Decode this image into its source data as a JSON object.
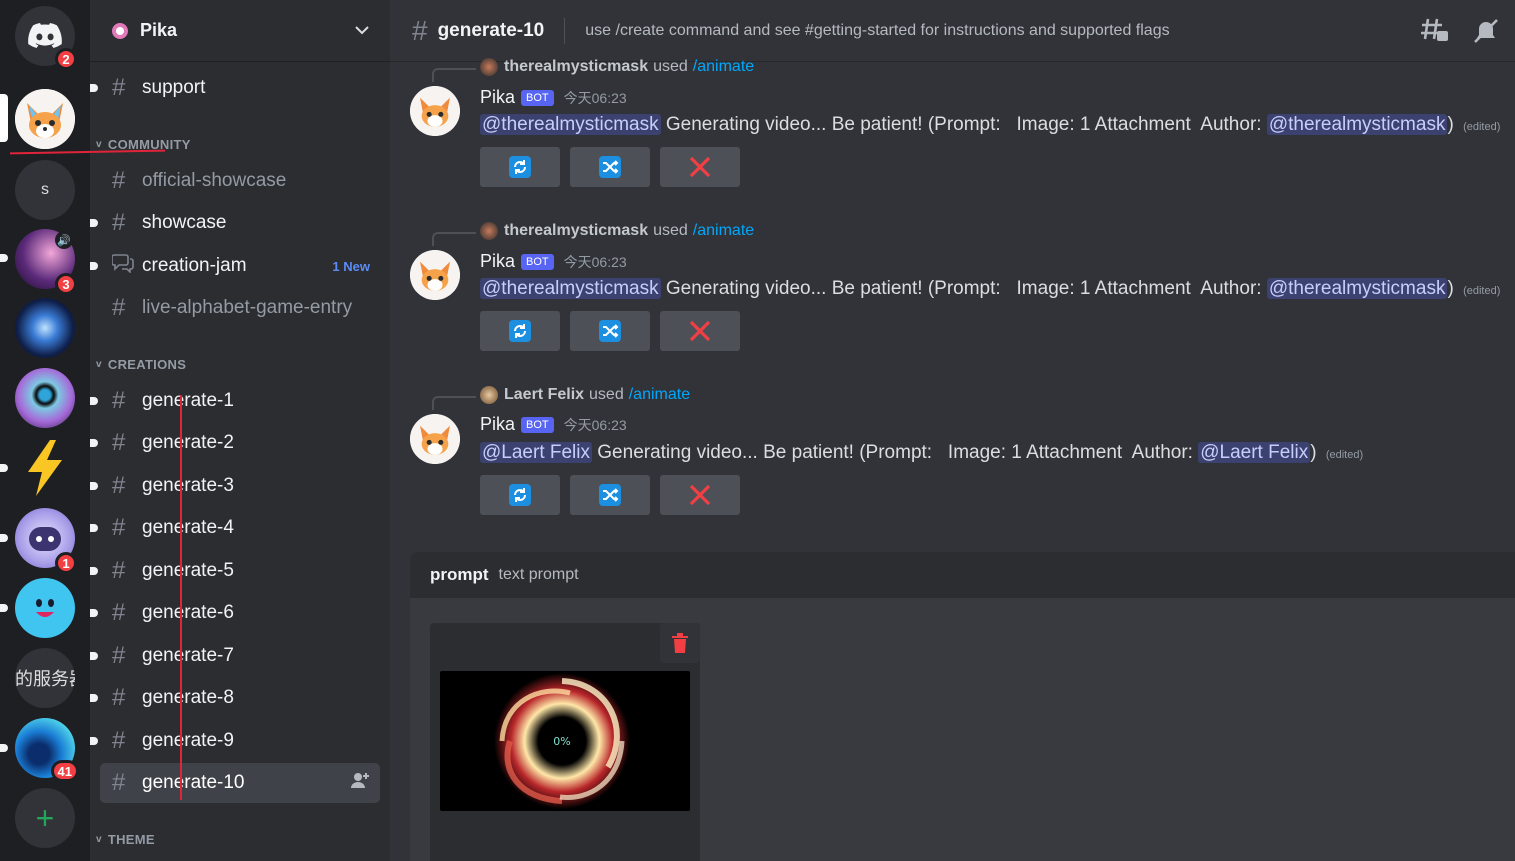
{
  "rail": {
    "servers": [
      {
        "name": "discord-home",
        "badge": "2"
      },
      {
        "name": "pika-server",
        "badge": ""
      },
      {
        "name": "s-server",
        "initial": "s",
        "badge": ""
      },
      {
        "name": "purple-server",
        "badge": "3"
      },
      {
        "name": "galaxy-server",
        "badge": ""
      },
      {
        "name": "eye-server",
        "badge": ""
      },
      {
        "name": "lightning-server",
        "badge": ""
      },
      {
        "name": "robot-server",
        "badge": "1"
      },
      {
        "name": "smile-server",
        "badge": ""
      },
      {
        "name": "text-server",
        "initial": "的服务器",
        "badge": ""
      },
      {
        "name": "edge-server",
        "badge": "41"
      }
    ]
  },
  "sidebar": {
    "server_name": "Pika",
    "channels_top": [
      {
        "name": "support"
      }
    ],
    "categories": {
      "community": "COMMUNITY",
      "creations": "CREATIONS",
      "theme": "THEME"
    },
    "community": [
      {
        "name": "official-showcase"
      },
      {
        "name": "showcase"
      },
      {
        "name": "creation-jam",
        "tag": "1 New"
      },
      {
        "name": "live-alphabet-game-entry"
      }
    ],
    "creations": [
      {
        "name": "generate-1"
      },
      {
        "name": "generate-2"
      },
      {
        "name": "generate-3"
      },
      {
        "name": "generate-4"
      },
      {
        "name": "generate-5"
      },
      {
        "name": "generate-6"
      },
      {
        "name": "generate-7"
      },
      {
        "name": "generate-8"
      },
      {
        "name": "generate-9"
      },
      {
        "name": "generate-10"
      }
    ]
  },
  "header": {
    "channel": "generate-10",
    "topic": "use /create command and see #getting-started for instructions and supported flags"
  },
  "messages": [
    {
      "reply_user": "therealmysticmask",
      "reply_used": "used",
      "reply_cmd": "/animate",
      "author": "Pika",
      "bot": "BOT",
      "time": "今天06:23",
      "mention": "@therealmysticmask",
      "text": "Generating video... Be patient! (Prompt:   Image: 1 Attachment  Author: ",
      "author_mention": "@therealmysticmask",
      "close": ")",
      "edited": "(edited)"
    },
    {
      "reply_user": "therealmysticmask",
      "reply_used": "used",
      "reply_cmd": "/animate",
      "author": "Pika",
      "bot": "BOT",
      "time": "今天06:23",
      "mention": "@therealmysticmask",
      "text": "Generating video... Be patient! (Prompt:   Image: 1 Attachment  Author: ",
      "author_mention": "@therealmysticmask",
      "close": ")",
      "edited": "(edited)"
    },
    {
      "reply_user": "Laert Felix",
      "reply_used": "used",
      "reply_cmd": "/animate",
      "author": "Pika",
      "bot": "BOT",
      "time": "今天06:23",
      "mention": "@Laert Felix",
      "text": "Generating video... Be patient! (Prompt:   Image: 1 Attachment  Author: ",
      "author_mention": "@Laert Felix",
      "close": ")",
      "edited": "(edited)"
    }
  ],
  "prompt": {
    "name": "prompt",
    "description": "text prompt"
  },
  "attachment": {
    "progress_label": "0%"
  },
  "colors": {
    "accent": "#5865f2",
    "badge": "#f23f43",
    "link": "#00a8fc",
    "danger": "#f23f43"
  }
}
